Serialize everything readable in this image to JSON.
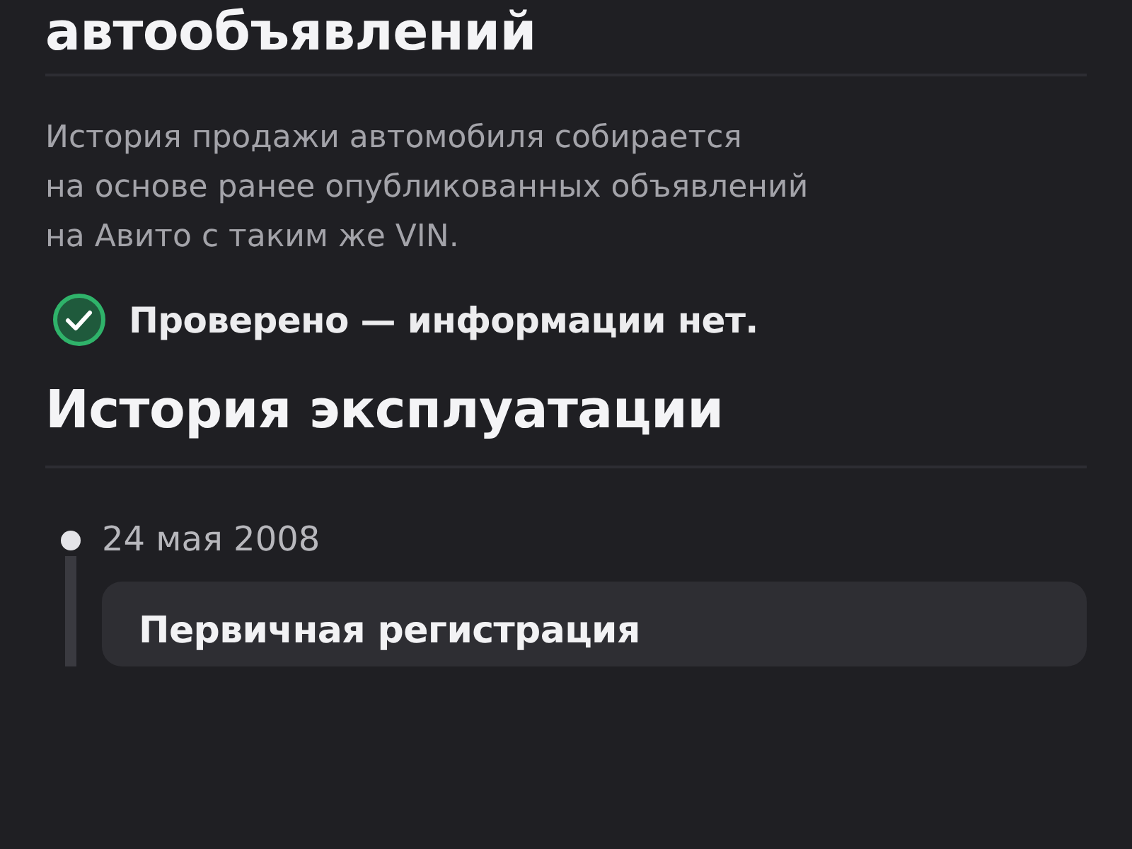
{
  "top_heading": "автообъявлений",
  "description": "История продажи автомобиля собирается\nна основе ранее опубликованных объявлений\nна Авито с таким же VIN.",
  "status": {
    "kind": "ok",
    "text": "Проверено — информации нет."
  },
  "section_title": "История эксплуатации",
  "timeline": [
    {
      "date": "24 мая 2008",
      "title": "Первичная регистрация"
    }
  ]
}
